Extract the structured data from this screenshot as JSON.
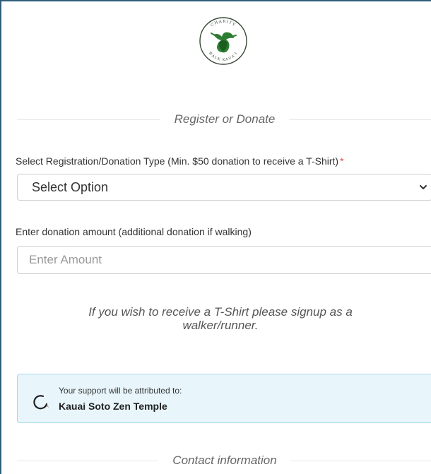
{
  "header": {
    "logo": {
      "icon": "charity-walk-kauai-logo",
      "top_text": "CHARITY",
      "bottom_text": "WALK KAUA'I"
    }
  },
  "register_section": {
    "title": "Register or Donate"
  },
  "registration_type": {
    "label": "Select Registration/Donation Type (Min. $50 donation to receive a T-Shirt)",
    "required_mark": "*",
    "selected_value": "Select Option"
  },
  "donation_amount": {
    "label": "Enter donation amount (additional donation if walking)",
    "placeholder": "Enter Amount",
    "value": ""
  },
  "tshirt_note": "If you wish to receive a T-Shirt please signup as a walker/runner.",
  "support": {
    "caption": "Your support will be attributed to:",
    "organization": "Kauai Soto Zen Temple",
    "icon": "enso-circle-icon"
  },
  "contact_section": {
    "title": "Contact information"
  },
  "colors": {
    "frame_border": "#2f5f7a",
    "required": "#d9534f",
    "support_bg": "#e8f6fc",
    "support_border": "#a9d8ec"
  }
}
